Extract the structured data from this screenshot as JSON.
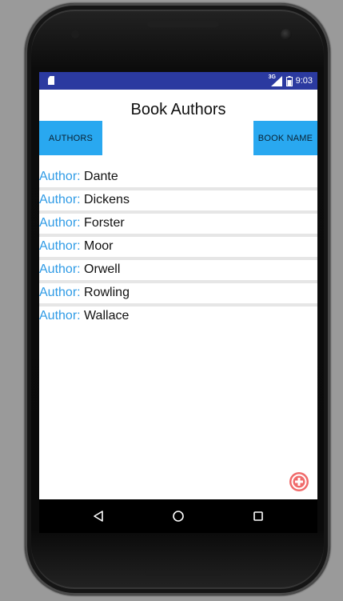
{
  "status_bar": {
    "network_label": "3G",
    "time": "9:03",
    "background": "#2b3aa0"
  },
  "app": {
    "title": "Book Authors"
  },
  "buttons": {
    "authors_label": "AUTHORS",
    "book_name_label": "BOOK NAME",
    "color": "#29a8f0"
  },
  "authors": {
    "prefix": "Author:",
    "items": [
      {
        "name": "Dante"
      },
      {
        "name": "Dickens"
      },
      {
        "name": "Forster"
      },
      {
        "name": "Moor"
      },
      {
        "name": "Orwell"
      },
      {
        "name": "Rowling"
      },
      {
        "name": "Wallace"
      }
    ]
  },
  "fab": {
    "icon": "add-circle-icon",
    "color": "#f06a6a"
  },
  "nav_bar": {
    "back_icon": "back-triangle-icon",
    "home_icon": "home-circle-icon",
    "recents_icon": "recents-square-icon"
  }
}
